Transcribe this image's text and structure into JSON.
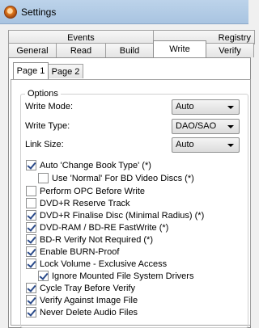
{
  "window": {
    "title": "Settings"
  },
  "tabs_row1": [
    "Events",
    "Registry"
  ],
  "tabs_row2": [
    "General",
    "Read",
    "Build",
    "Write",
    "Verify"
  ],
  "active_tab": "Write",
  "subtabs": [
    "Page 1",
    "Page 2"
  ],
  "active_subtab": "Page 1",
  "options": {
    "group_label": "Options",
    "write_mode_label": "Write Mode:",
    "write_mode_value": "Auto",
    "write_type_label": "Write Type:",
    "write_type_value": "DAO/SAO",
    "link_size_label": "Link Size:",
    "link_size_value": "Auto"
  },
  "checkboxes": [
    {
      "label": "Auto 'Change Book Type' (*)",
      "checked": true
    },
    {
      "label": "Use 'Normal' For BD Video Discs (*)",
      "checked": false
    },
    {
      "label": "Perform OPC Before Write",
      "checked": false
    },
    {
      "label": "DVD+R Reserve Track",
      "checked": false
    },
    {
      "label": "DVD+R Finalise Disc (Minimal Radius) (*)",
      "checked": true
    },
    {
      "label": "DVD-RAM / BD-RE FastWrite (*)",
      "checked": true
    },
    {
      "label": "BD-R Verify Not Required (*)",
      "checked": true
    },
    {
      "label": "Enable BURN-Proof",
      "checked": true
    },
    {
      "label": "Lock Volume - Exclusive Access",
      "checked": true
    },
    {
      "label": "Ignore Mounted File System Drivers",
      "checked": true
    },
    {
      "label": "Cycle Tray Before Verify",
      "checked": true
    },
    {
      "label": "Verify Against Image File",
      "checked": true
    },
    {
      "label": "Never Delete Audio Files",
      "checked": true
    }
  ]
}
